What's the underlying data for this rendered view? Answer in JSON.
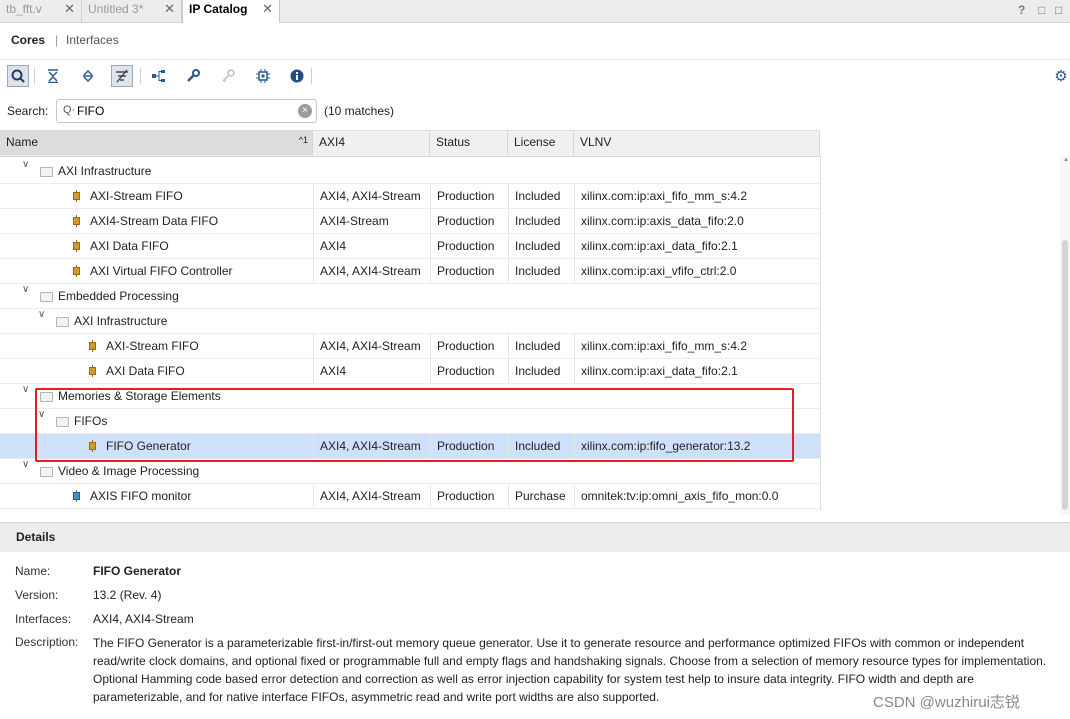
{
  "tabs": [
    {
      "label": "tb_fft.v"
    },
    {
      "label": "Untitled 3*"
    },
    {
      "label": "IP Catalog"
    }
  ],
  "window_controls": {
    "help": "?",
    "restore": "□",
    "maximize": "□"
  },
  "subtabs": {
    "cores": "Cores",
    "separator": "|",
    "interfaces": "Interfaces"
  },
  "toolbar": [
    {
      "icon": "search-icon",
      "glyph": "⚲"
    },
    {
      "icon": "collapse-all-icon",
      "glyph": "⇟"
    },
    {
      "icon": "expand-all-icon",
      "glyph": "⇕"
    },
    {
      "icon": "filter-icon",
      "glyph": "⧩"
    },
    {
      "icon": "hierarchy-icon",
      "glyph": "⊞"
    },
    {
      "icon": "wrench-icon",
      "glyph": "🔧"
    },
    {
      "icon": "key-icon",
      "glyph": "⚿"
    },
    {
      "icon": "chip-icon",
      "glyph": "▣"
    },
    {
      "icon": "info-icon",
      "glyph": "ℹ"
    }
  ],
  "settings_icon": "⚙",
  "search": {
    "label": "Search:",
    "value": "FIFO",
    "matches": "(10 matches)",
    "clear": "×",
    "mag": "Q·"
  },
  "columns": {
    "name": "Name",
    "sort": "^1",
    "axi4": "AXI4",
    "status": "Status",
    "license": "License",
    "vlnv": "VLNV"
  },
  "rows": [
    {
      "type": "folder",
      "level": 0,
      "name": "AXI Infrastructure"
    },
    {
      "type": "ip",
      "level": 1,
      "name": "AXI-Stream FIFO",
      "axi4": "AXI4, AXI4-Stream",
      "status": "Production",
      "license": "Included",
      "vlnv": "xilinx.com:ip:axi_fifo_mm_s:4.2"
    },
    {
      "type": "ip",
      "level": 1,
      "name": "AXI4-Stream Data FIFO",
      "axi4": "AXI4-Stream",
      "status": "Production",
      "license": "Included",
      "vlnv": "xilinx.com:ip:axis_data_fifo:2.0"
    },
    {
      "type": "ip",
      "level": 1,
      "name": "AXI Data FIFO",
      "axi4": "AXI4",
      "status": "Production",
      "license": "Included",
      "vlnv": "xilinx.com:ip:axi_data_fifo:2.1"
    },
    {
      "type": "ip",
      "level": 1,
      "name": "AXI Virtual FIFO Controller",
      "axi4": "AXI4, AXI4-Stream",
      "status": "Production",
      "license": "Included",
      "vlnv": "xilinx.com:ip:axi_vfifo_ctrl:2.0"
    },
    {
      "type": "folder",
      "level": 0,
      "name": "Embedded Processing"
    },
    {
      "type": "folder",
      "level": 1,
      "name": "AXI Infrastructure"
    },
    {
      "type": "ip",
      "level": 2,
      "name": "AXI-Stream FIFO",
      "axi4": "AXI4, AXI4-Stream",
      "status": "Production",
      "license": "Included",
      "vlnv": "xilinx.com:ip:axi_fifo_mm_s:4.2"
    },
    {
      "type": "ip",
      "level": 2,
      "name": "AXI Data FIFO",
      "axi4": "AXI4",
      "status": "Production",
      "license": "Included",
      "vlnv": "xilinx.com:ip:axi_data_fifo:2.1"
    },
    {
      "type": "folder",
      "level": 0,
      "name": "Memories & Storage Elements"
    },
    {
      "type": "folder",
      "level": 1,
      "name": "FIFOs"
    },
    {
      "type": "ip",
      "level": 2,
      "name": "FIFO Generator",
      "axi4": "AXI4, AXI4-Stream",
      "status": "Production",
      "license": "Included",
      "vlnv": "xilinx.com:ip:fifo_generator:13.2",
      "selected": true
    },
    {
      "type": "folder",
      "level": 0,
      "name": "Video & Image Processing"
    },
    {
      "type": "ip",
      "level": 1,
      "name": "AXIS FIFO monitor",
      "axi4": "AXI4, AXI4-Stream",
      "status": "Production",
      "license": "Purchase",
      "vlnv": "omnitek:tv:ip:omni_axis_fifo_mon:0.0",
      "blue": true
    }
  ],
  "details": {
    "title": "Details",
    "name_label": "Name:",
    "name": "FIFO Generator",
    "version_label": "Version:",
    "version": "13.2 (Rev. 4)",
    "interfaces_label": "Interfaces:",
    "interfaces": "AXI4, AXI4-Stream",
    "description_label": "Description:",
    "description": "The FIFO Generator is a parameterizable first-in/first-out memory queue generator. Use it to generate resource and performance optimized FIFOs with common or independent read/write clock domains, and optional fixed or programmable full and empty flags and handshaking signals.  Choose from a selection of memory resource types for implementation.  Optional Hamming code based error detection and correction as well as error injection capability for system test help to insure data integrity.  FIFO width and depth are parameterizable, and for native interface FIFOs, asymmetric read and write port widths are also supported."
  },
  "watermark": "CSDN @wuzhirui志锐"
}
